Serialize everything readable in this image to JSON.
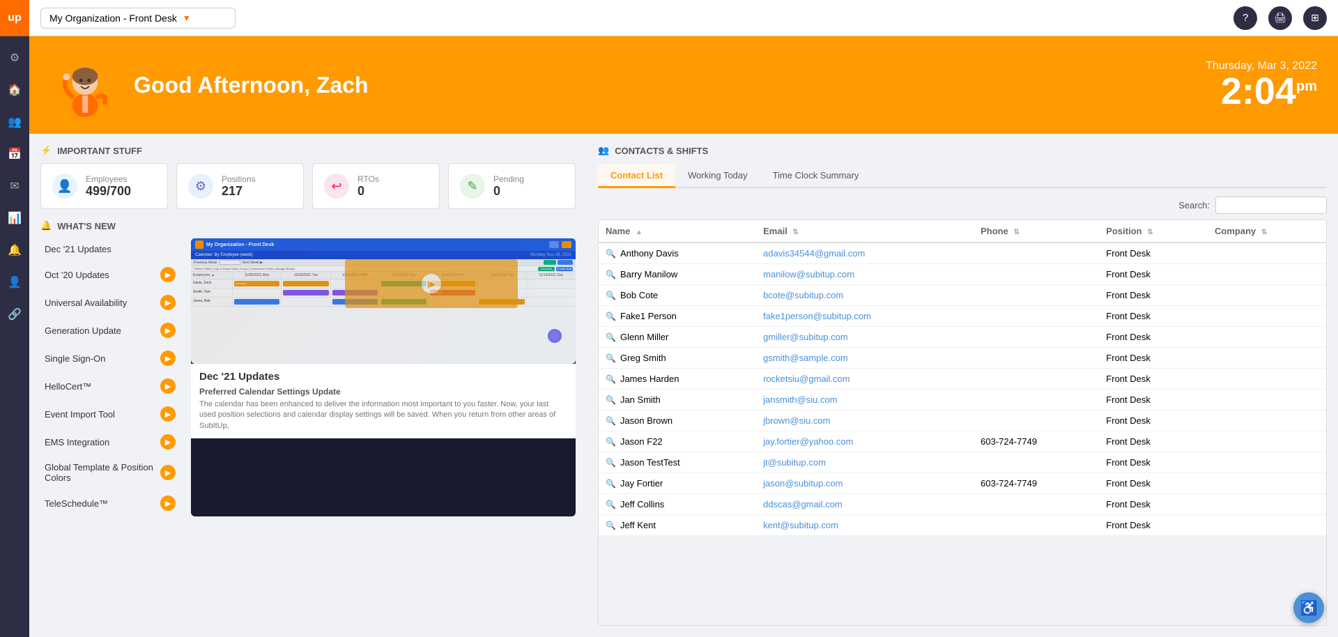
{
  "topbar": {
    "org_label": "My Organization - Front Desk",
    "icons": {
      "help": "?",
      "print": "🖨",
      "grid": "⊞"
    }
  },
  "hero": {
    "greeting": "Good Afternoon, Zach",
    "date": "Thursday, Mar 3, 2022",
    "time": "2:04",
    "ampm": "pm"
  },
  "important_stuff": {
    "header": "IMPORTANT STUFF",
    "stats": [
      {
        "label": "Employees",
        "value": "499/700",
        "icon": "👤"
      },
      {
        "label": "Positions",
        "value": "217",
        "icon": "⚙"
      },
      {
        "label": "RTOs",
        "value": "0",
        "icon": "↩"
      },
      {
        "label": "Pending",
        "value": "0",
        "icon": "✎"
      }
    ]
  },
  "whats_new": {
    "header": "WHAT'S NEW",
    "items": [
      {
        "label": "Dec '21 Updates",
        "has_arrow": true
      },
      {
        "label": "Oct '20 Updates",
        "has_arrow": true
      },
      {
        "label": "Universal Availability",
        "has_arrow": true
      },
      {
        "label": "Generation Update",
        "has_arrow": true
      },
      {
        "label": "Single Sign-On",
        "has_arrow": true
      },
      {
        "label": "HelloCert™",
        "has_arrow": true
      },
      {
        "label": "Event Import Tool",
        "has_arrow": true
      },
      {
        "label": "EMS Integration",
        "has_arrow": true
      },
      {
        "label": "Global Template & Position Colors",
        "has_arrow": true
      },
      {
        "label": "TeleSchedule™",
        "has_arrow": true
      }
    ],
    "video": {
      "title": "Dec '21 Updates",
      "subtitle": "Preferred Calendar Settings Update",
      "description": "The calendar has been enhanced to deliver the information most important to you faster. Now, your last used position selections and calendar display settings will be saved. When you return from other areas of SubItUp,"
    }
  },
  "contacts": {
    "header": "CONTACTS & SHIFTS",
    "tabs": [
      {
        "label": "Contact List",
        "active": true
      },
      {
        "label": "Working Today",
        "active": false
      },
      {
        "label": "Time Clock Summary",
        "active": false
      }
    ],
    "search_label": "Search:",
    "columns": [
      {
        "label": "Name",
        "sortable": true
      },
      {
        "label": "Email",
        "sortable": true
      },
      {
        "label": "Phone",
        "sortable": true
      },
      {
        "label": "Position",
        "sortable": true
      },
      {
        "label": "Company",
        "sortable": true
      }
    ],
    "rows": [
      {
        "name": "Anthony Davis",
        "email": "adavis34544@gmail.com",
        "phone": "",
        "position": "Front Desk",
        "company": ""
      },
      {
        "name": "Barry Manilow",
        "email": "manilow@subitup.com",
        "phone": "",
        "position": "Front Desk",
        "company": ""
      },
      {
        "name": "Bob Cote",
        "email": "bcote@subitup.com",
        "phone": "",
        "position": "Front Desk",
        "company": ""
      },
      {
        "name": "Fake1 Person",
        "email": "fake1person@subitup.com",
        "phone": "",
        "position": "Front Desk",
        "company": ""
      },
      {
        "name": "Glenn Miller",
        "email": "gmiller@subitup.com",
        "phone": "",
        "position": "Front Desk",
        "company": ""
      },
      {
        "name": "Greg Smith",
        "email": "gsmith@sample.com",
        "phone": "",
        "position": "Front Desk",
        "company": ""
      },
      {
        "name": "James Harden",
        "email": "rocketsiu@gmail.com",
        "phone": "",
        "position": "Front Desk",
        "company": ""
      },
      {
        "name": "Jan Smith",
        "email": "jansmith@siu.com",
        "phone": "",
        "position": "Front Desk",
        "company": ""
      },
      {
        "name": "Jason Brown",
        "email": "jbrown@siu.com",
        "phone": "",
        "position": "Front Desk",
        "company": ""
      },
      {
        "name": "Jason F22",
        "email": "jay.fortier@yahoo.com",
        "phone": "603-724-7749",
        "position": "Front Desk",
        "company": ""
      },
      {
        "name": "Jason TestTest",
        "email": "jt@subitup.com",
        "phone": "",
        "position": "Front Desk",
        "company": ""
      },
      {
        "name": "Jay Fortier",
        "email": "jason@subitup.com",
        "phone": "603-724-7749",
        "position": "Front Desk",
        "company": ""
      },
      {
        "name": "Jeff Collins",
        "email": "ddscas@gmail.com",
        "phone": "",
        "position": "Front Desk",
        "company": ""
      },
      {
        "name": "Jeff Kent",
        "email": "kent@subitup.com",
        "phone": "",
        "position": "Front Desk",
        "company": ""
      }
    ]
  },
  "sidebar": {
    "logo": "up",
    "icons": [
      "⚙",
      "🏠",
      "👥",
      "📅",
      "✉",
      "📊",
      "🔔",
      "👤",
      "🔗"
    ]
  }
}
